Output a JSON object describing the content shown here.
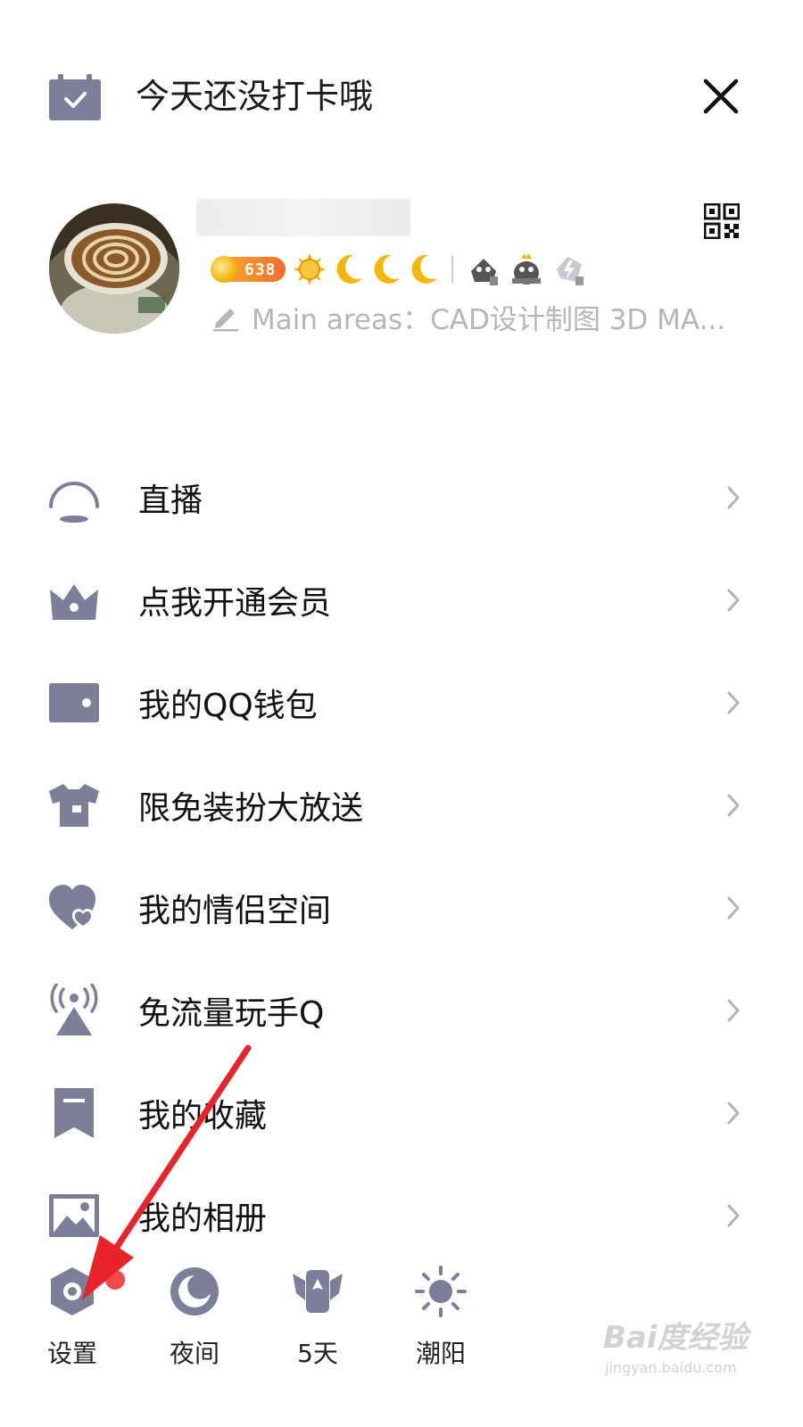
{
  "header": {
    "checkin_text": "今天还没打卡哦",
    "calendar_icon": "calendar-check-icon",
    "close_icon": "close-icon"
  },
  "profile": {
    "coin_count": "638",
    "signature": "Main areas：CAD设计制图  3D MA...",
    "qr_icon": "qr-code-icon",
    "edit_icon": "pencil-icon"
  },
  "menu": [
    {
      "label": "直播",
      "icon": "live-icon"
    },
    {
      "label": "点我开通会员",
      "icon": "crown-icon"
    },
    {
      "label": "我的QQ钱包",
      "icon": "wallet-icon"
    },
    {
      "label": "限免装扮大放送",
      "icon": "tshirt-icon"
    },
    {
      "label": "我的情侣空间",
      "icon": "heart-icon"
    },
    {
      "label": "免流量玩手Q",
      "icon": "signal-tower-icon"
    },
    {
      "label": "我的收藏",
      "icon": "bookmark-icon"
    },
    {
      "label": "我的相册",
      "icon": "photo-icon"
    }
  ],
  "bottom_bar": [
    {
      "label": "设置",
      "icon": "settings-icon",
      "has_badge": true
    },
    {
      "label": "夜间",
      "icon": "night-mode-icon"
    },
    {
      "label": "5天",
      "icon": "winged-badge-icon"
    },
    {
      "label": "潮阳",
      "icon": "weather-sun-icon"
    }
  ],
  "watermark": {
    "main": "Bai度经验",
    "sub": "jingyan.baidu.com"
  },
  "colors": {
    "icon": "#7d7f98",
    "arrow": "#e8232a",
    "badge": "#f04a4a"
  }
}
